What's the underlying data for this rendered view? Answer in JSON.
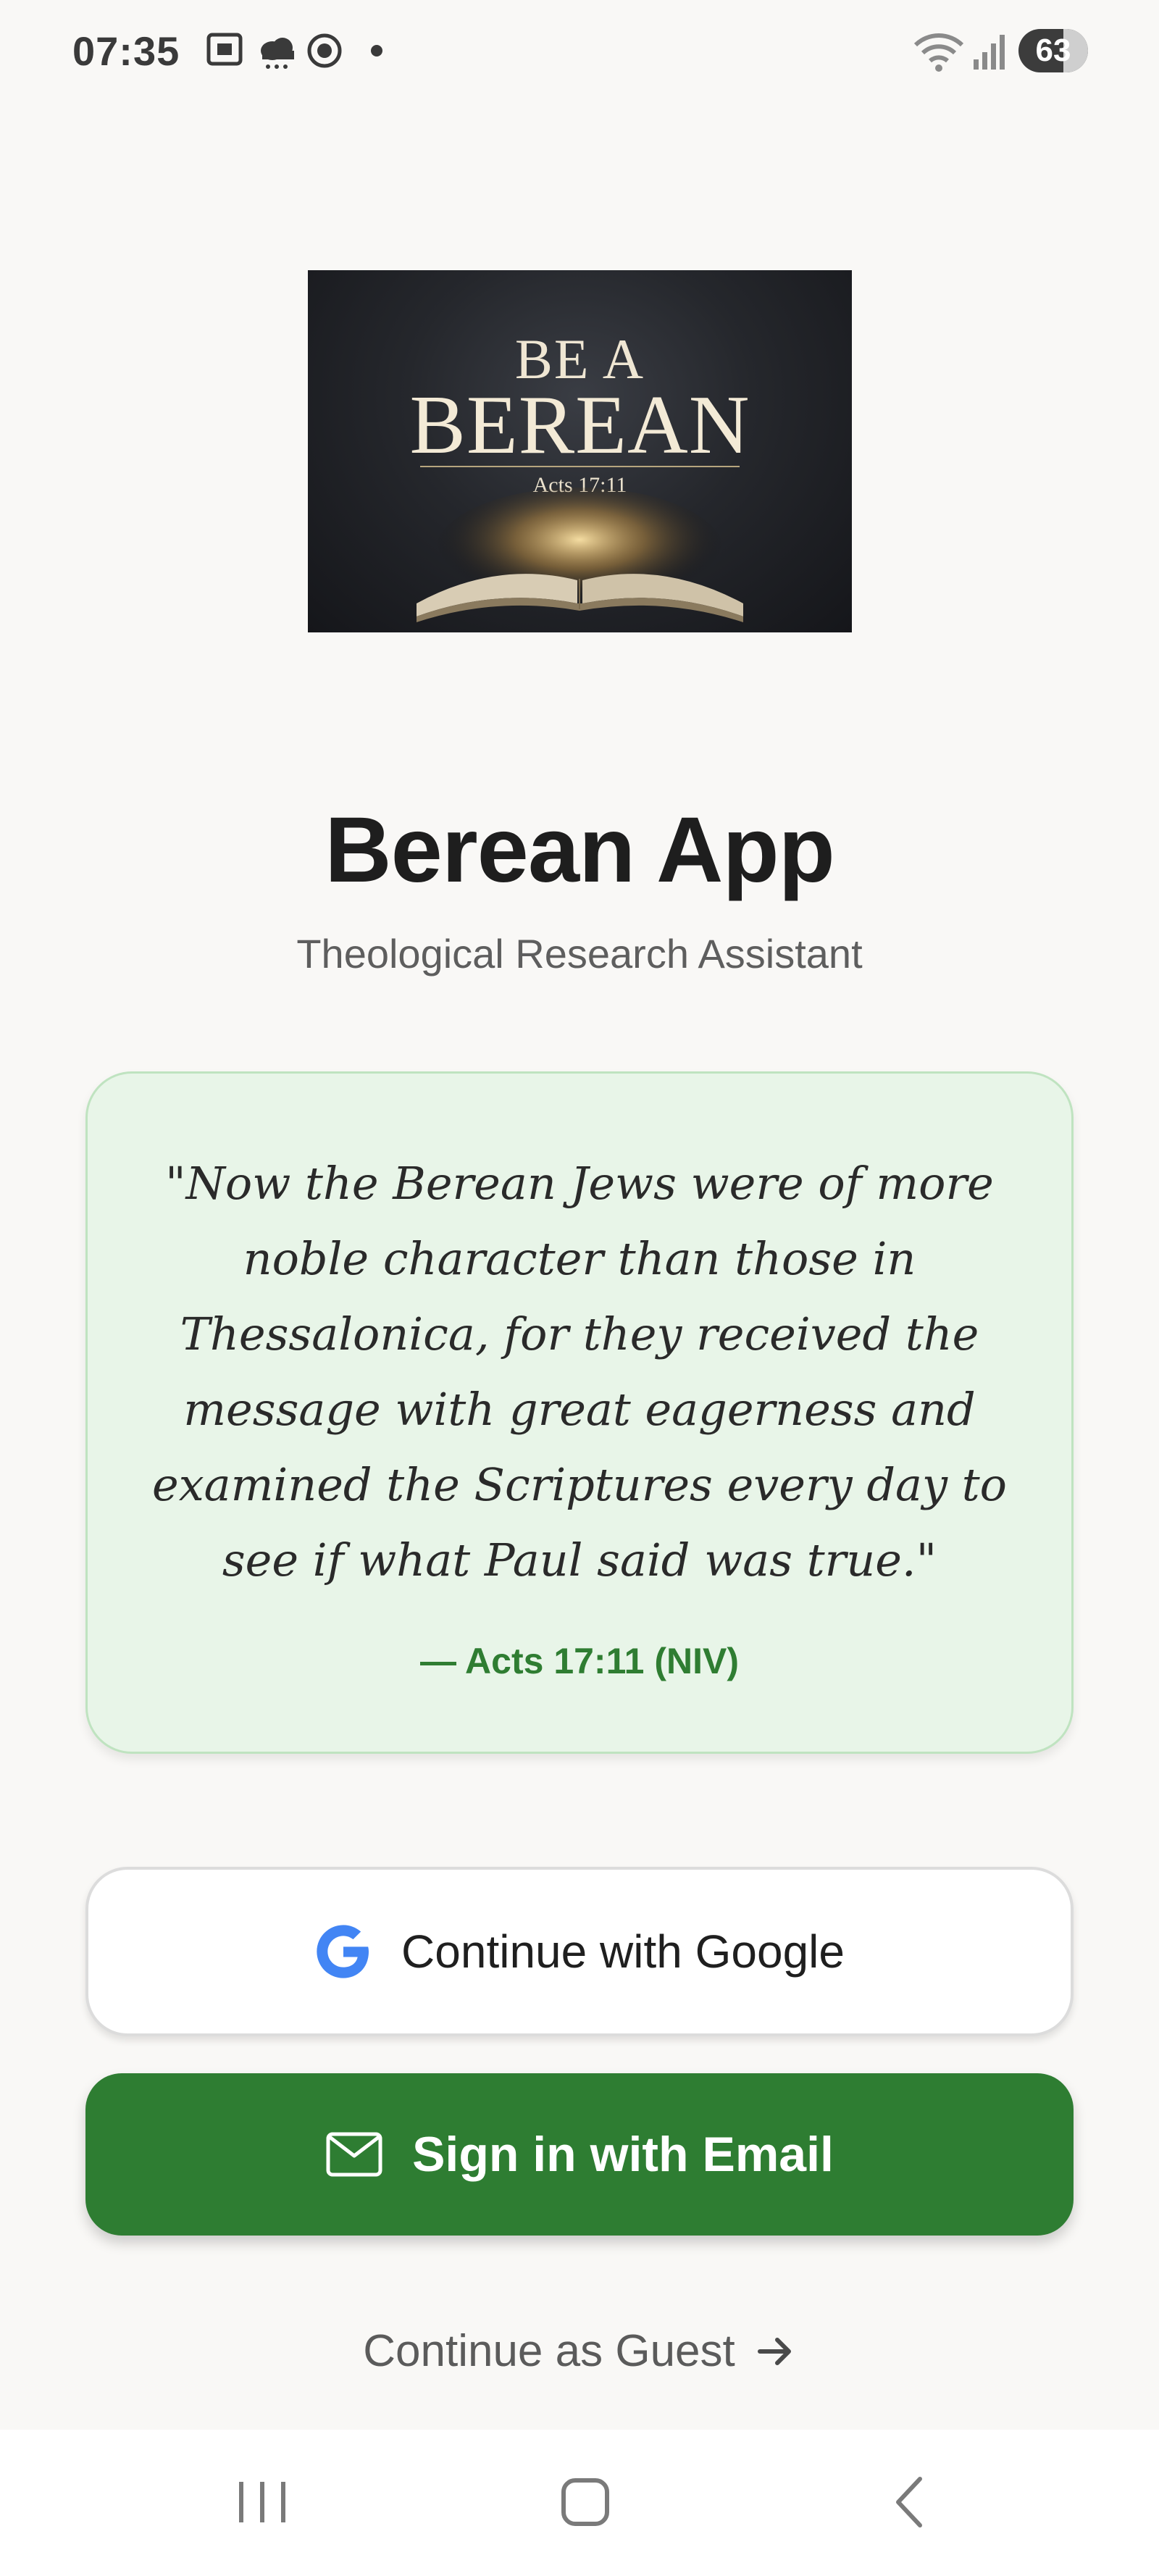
{
  "status_bar": {
    "time": "07:35",
    "battery": "63",
    "icons": [
      "screenshot-icon",
      "weather-icon",
      "record-icon",
      "dot-icon",
      "wifi-icon",
      "signal-icon"
    ]
  },
  "logo": {
    "line1": "BE A",
    "line2": "BEREAN",
    "reference": "Acts 17:11"
  },
  "header": {
    "title": "Berean App",
    "subtitle": "Theological Research Assistant"
  },
  "verse": {
    "text": "\"Now the Berean Jews were of more noble character than those in Thessalonica, for they received the message with great eagerness and examined the Scriptures every day to see if what Paul said was true.\"",
    "reference": "— Acts 17:11 (NIV)"
  },
  "auth": {
    "google_label": "Continue with Google",
    "email_label": "Sign in with Email",
    "guest_label": "Continue as Guest"
  },
  "navigation": {
    "buttons": [
      "recent-apps-icon",
      "home-icon",
      "back-icon"
    ]
  },
  "colors": {
    "accent": "#2e7d32",
    "card_background": "#e8f5e8",
    "page_background": "#f9f8f6"
  }
}
